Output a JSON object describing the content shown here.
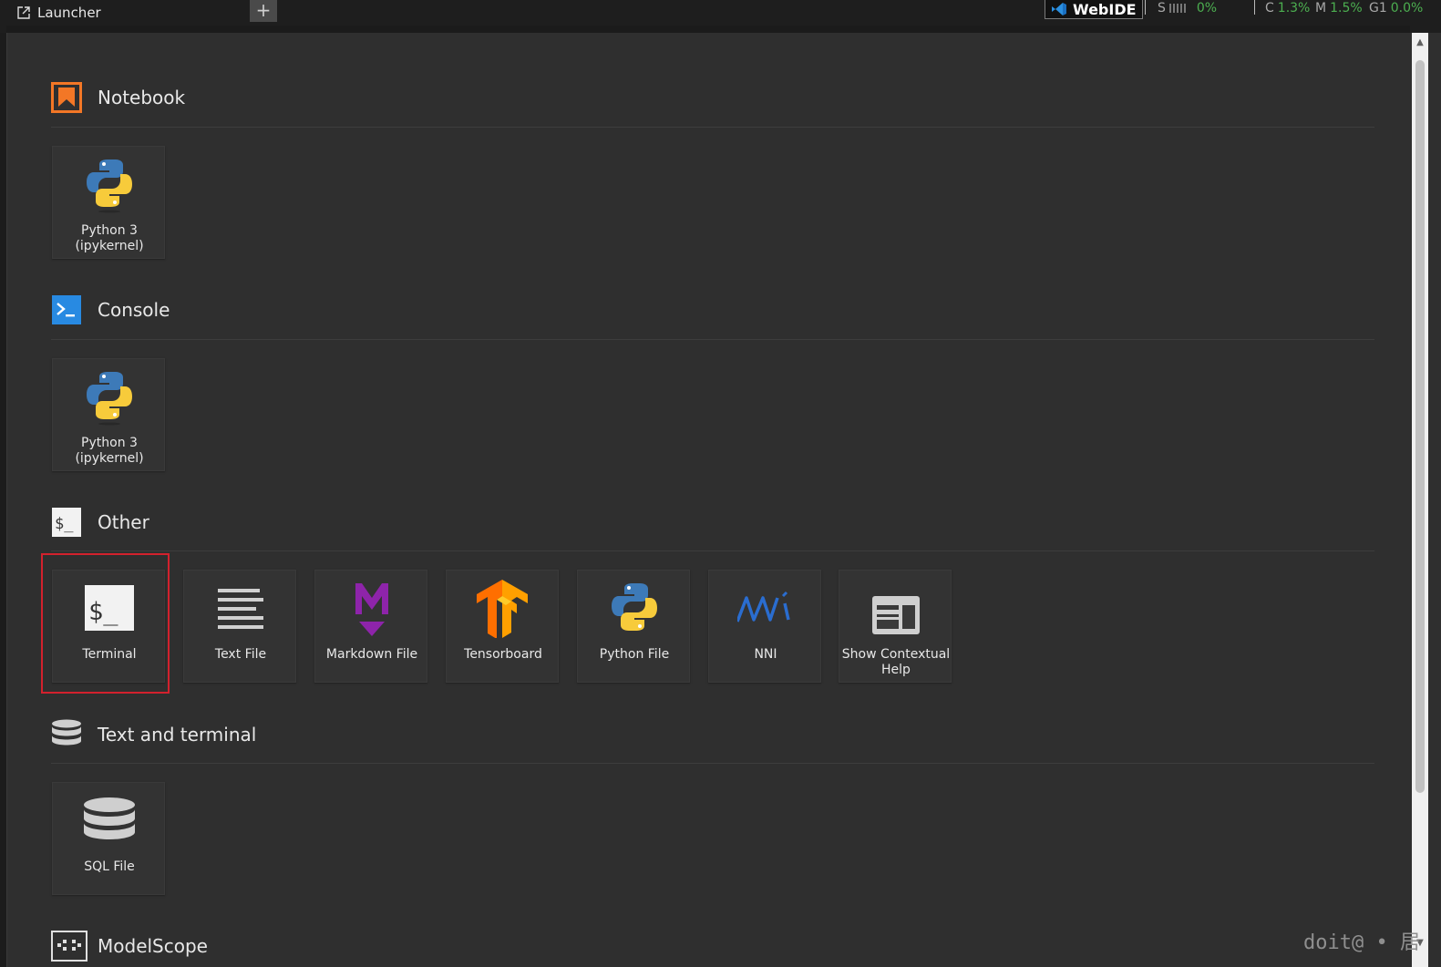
{
  "tabs": {
    "active_label": "Launcher",
    "add_label": "+"
  },
  "toolbar": {
    "webide_label": "WebIDE",
    "stats": {
      "s_label": "S",
      "s_value": "0%",
      "c_label": "C",
      "c_value": "1.3%",
      "m_label": "M",
      "m_value": "1.5%",
      "g_label": "G1",
      "g_value": "0.0%"
    }
  },
  "sections": {
    "notebook": {
      "title": "Notebook",
      "items": [
        {
          "label": "Python 3\n(ipykernel)",
          "icon": "python-icon"
        }
      ]
    },
    "console": {
      "title": "Console",
      "items": [
        {
          "label": "Python 3\n(ipykernel)",
          "icon": "python-icon"
        }
      ]
    },
    "other": {
      "title": "Other",
      "items": [
        {
          "label": "Terminal",
          "icon": "terminal-icon"
        },
        {
          "label": "Text File",
          "icon": "text-file-icon"
        },
        {
          "label": "Markdown File",
          "icon": "markdown-icon"
        },
        {
          "label": "Tensorboard",
          "icon": "tensorflow-icon"
        },
        {
          "label": "Python File",
          "icon": "python-icon"
        },
        {
          "label": "NNI",
          "icon": "nni-icon"
        },
        {
          "label": "Show Contextual\nHelp",
          "icon": "contextual-help-icon"
        }
      ]
    },
    "text_terminal": {
      "title": "Text and terminal",
      "items": [
        {
          "label": "SQL File",
          "icon": "database-icon"
        }
      ]
    },
    "modelscope": {
      "title": "ModelScope"
    }
  },
  "watermark": "doit@ • 居",
  "colors": {
    "notebook_orange": "#f37726",
    "console_blue": "#288ae2",
    "highlight_red": "#d3212d",
    "status_green": "#4caf50"
  }
}
